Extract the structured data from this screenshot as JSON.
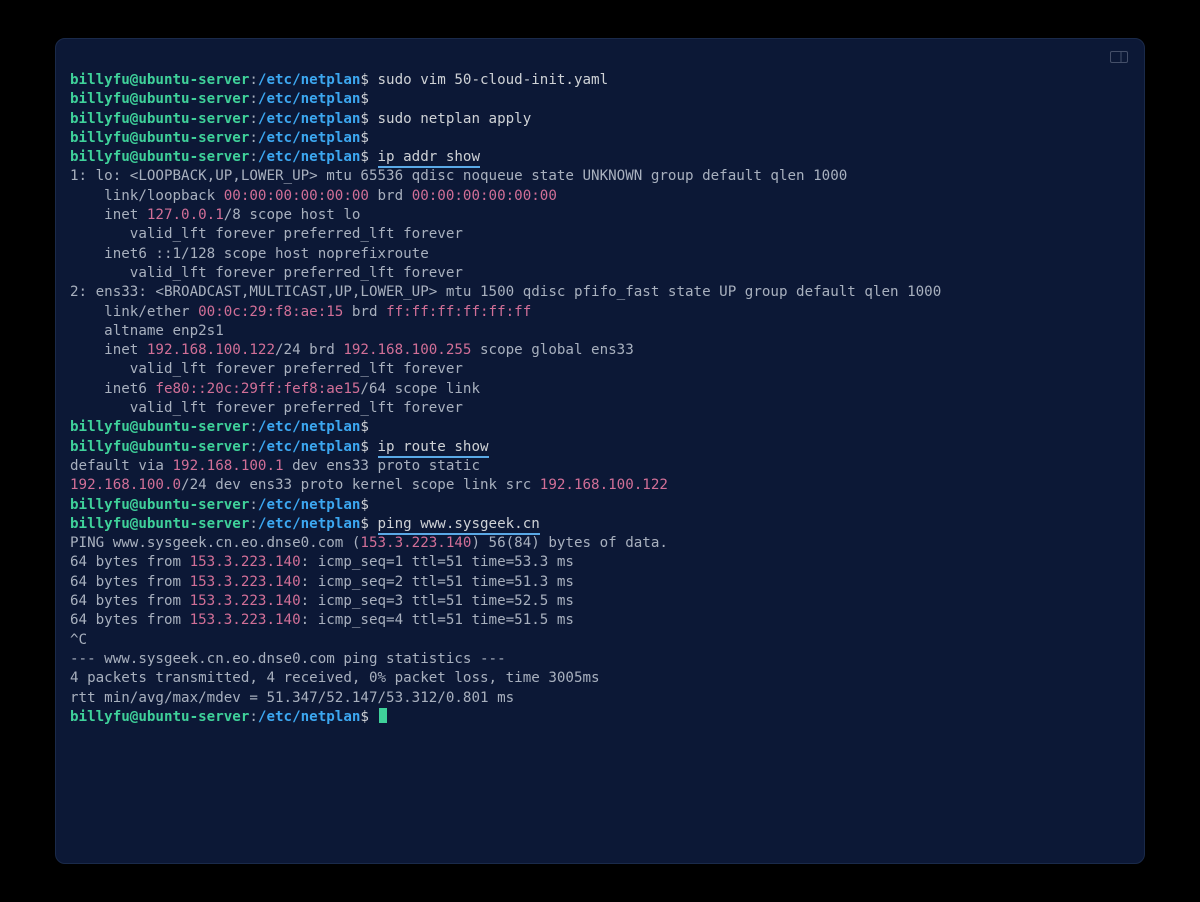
{
  "prompt": {
    "user": "billyfu@ubuntu-server",
    "path": "/etc/netplan",
    "symbol": "$"
  },
  "lines": [
    {
      "t": "prompt",
      "cmd": "sudo vim 50-cloud-init.yaml"
    },
    {
      "t": "prompt",
      "cmd": ""
    },
    {
      "t": "prompt",
      "cmd": "sudo netplan apply"
    },
    {
      "t": "prompt",
      "cmd": ""
    },
    {
      "t": "prompt",
      "cmd": "ip addr show",
      "hl": true
    },
    {
      "t": "out",
      "text": "1: lo: <LOOPBACK,UP,LOWER_UP> mtu 65536 qdisc noqueue state UNKNOWN group default qlen 1000"
    },
    {
      "t": "mixed",
      "segs": [
        {
          "c": "out",
          "v": "    link/loopback "
        },
        {
          "c": "mac",
          "v": "00:00:00:00:00:00"
        },
        {
          "c": "out",
          "v": " brd "
        },
        {
          "c": "mac",
          "v": "00:00:00:00:00:00"
        }
      ]
    },
    {
      "t": "mixed",
      "segs": [
        {
          "c": "out",
          "v": "    inet "
        },
        {
          "c": "ip",
          "v": "127.0.0.1"
        },
        {
          "c": "out",
          "v": "/8 scope host lo"
        }
      ]
    },
    {
      "t": "out",
      "text": "       valid_lft forever preferred_lft forever"
    },
    {
      "t": "out",
      "text": "    inet6 ::1/128 scope host noprefixroute"
    },
    {
      "t": "out",
      "text": "       valid_lft forever preferred_lft forever"
    },
    {
      "t": "out",
      "text": "2: ens33: <BROADCAST,MULTICAST,UP,LOWER_UP> mtu 1500 qdisc pfifo_fast state UP group default qlen 1000"
    },
    {
      "t": "mixed",
      "segs": [
        {
          "c": "out",
          "v": "    link/ether "
        },
        {
          "c": "mac",
          "v": "00:0c:29:f8:ae:15"
        },
        {
          "c": "out",
          "v": " brd "
        },
        {
          "c": "mac",
          "v": "ff:ff:ff:ff:ff:ff"
        }
      ]
    },
    {
      "t": "out",
      "text": "    altname enp2s1"
    },
    {
      "t": "mixed",
      "segs": [
        {
          "c": "out",
          "v": "    inet "
        },
        {
          "c": "ip",
          "v": "192.168.100.122"
        },
        {
          "c": "out",
          "v": "/24 brd "
        },
        {
          "c": "ip",
          "v": "192.168.100.255"
        },
        {
          "c": "out",
          "v": " scope global ens33"
        }
      ]
    },
    {
      "t": "out",
      "text": "       valid_lft forever preferred_lft forever"
    },
    {
      "t": "mixed",
      "segs": [
        {
          "c": "out",
          "v": "    inet6 "
        },
        {
          "c": "mac",
          "v": "fe80::20c:29ff:fef8:ae15"
        },
        {
          "c": "out",
          "v": "/64 scope link"
        }
      ]
    },
    {
      "t": "out",
      "text": "       valid_lft forever preferred_lft forever"
    },
    {
      "t": "prompt",
      "cmd": ""
    },
    {
      "t": "prompt",
      "cmd": "ip route show",
      "hl": true
    },
    {
      "t": "mixed",
      "segs": [
        {
          "c": "out",
          "v": "default via "
        },
        {
          "c": "ip",
          "v": "192.168.100.1"
        },
        {
          "c": "out",
          "v": " dev ens33 proto static"
        }
      ]
    },
    {
      "t": "mixed",
      "segs": [
        {
          "c": "ip",
          "v": "192.168.100.0"
        },
        {
          "c": "out",
          "v": "/24 dev ens33 proto kernel scope link src "
        },
        {
          "c": "ip",
          "v": "192.168.100.122"
        }
      ]
    },
    {
      "t": "prompt",
      "cmd": ""
    },
    {
      "t": "prompt",
      "cmd": "ping www.sysgeek.cn",
      "hl": true
    },
    {
      "t": "mixed",
      "segs": [
        {
          "c": "out",
          "v": "PING www.sysgeek.cn.eo.dnse0.com ("
        },
        {
          "c": "ip",
          "v": "153.3.223.140"
        },
        {
          "c": "out",
          "v": ") 56(84) bytes of data."
        }
      ]
    },
    {
      "t": "mixed",
      "segs": [
        {
          "c": "out",
          "v": "64 bytes from "
        },
        {
          "c": "ip",
          "v": "153.3.223.140"
        },
        {
          "c": "out",
          "v": ": icmp_seq=1 ttl=51 time=53.3 ms"
        }
      ]
    },
    {
      "t": "mixed",
      "segs": [
        {
          "c": "out",
          "v": "64 bytes from "
        },
        {
          "c": "ip",
          "v": "153.3.223.140"
        },
        {
          "c": "out",
          "v": ": icmp_seq=2 ttl=51 time=51.3 ms"
        }
      ]
    },
    {
      "t": "mixed",
      "segs": [
        {
          "c": "out",
          "v": "64 bytes from "
        },
        {
          "c": "ip",
          "v": "153.3.223.140"
        },
        {
          "c": "out",
          "v": ": icmp_seq=3 ttl=51 time=52.5 ms"
        }
      ]
    },
    {
      "t": "mixed",
      "segs": [
        {
          "c": "out",
          "v": "64 bytes from "
        },
        {
          "c": "ip",
          "v": "153.3.223.140"
        },
        {
          "c": "out",
          "v": ": icmp_seq=4 ttl=51 time=51.5 ms"
        }
      ]
    },
    {
      "t": "out",
      "text": "^C"
    },
    {
      "t": "out",
      "text": "--- www.sysgeek.cn.eo.dnse0.com ping statistics ---"
    },
    {
      "t": "out",
      "text": "4 packets transmitted, 4 received, 0% packet loss, time 3005ms"
    },
    {
      "t": "out",
      "text": "rtt min/avg/max/mdev = 51.347/52.147/53.312/0.801 ms"
    },
    {
      "t": "prompt",
      "cmd": "",
      "cursor": true
    }
  ]
}
